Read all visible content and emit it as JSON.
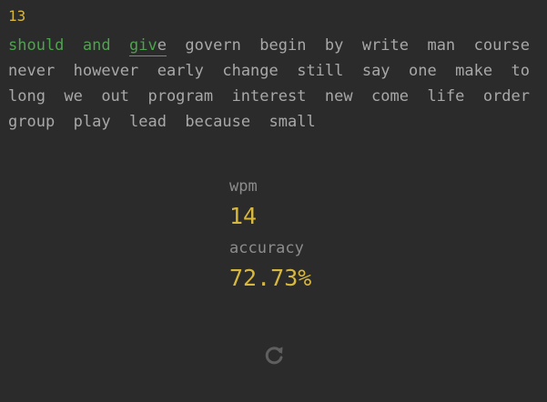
{
  "timer": "13",
  "words": {
    "completed": [
      "should",
      "and"
    ],
    "active": {
      "typed": "giv",
      "rest": "e"
    },
    "remaining": [
      "govern",
      "begin",
      "by",
      "write",
      "man",
      "course",
      "never",
      "however",
      "early",
      "change",
      "still",
      "say",
      "one",
      "make",
      "to",
      "long",
      "we",
      "out",
      "program",
      "interest",
      "new",
      "come",
      "life",
      "order",
      "group",
      "play",
      "lead",
      "because",
      "small"
    ]
  },
  "results": {
    "wpm_label": "wpm",
    "wpm_value": "14",
    "accuracy_label": "accuracy",
    "accuracy_value": "72.73%"
  },
  "icons": {
    "restart": "restart-icon"
  },
  "colors": {
    "background": "#2b2b2b",
    "accent": "#d7b73d",
    "correct": "#4fa24f",
    "untyped": "#a8a8a8",
    "caret_underline": "#c96a4c",
    "muted": "#8c8c8c"
  }
}
